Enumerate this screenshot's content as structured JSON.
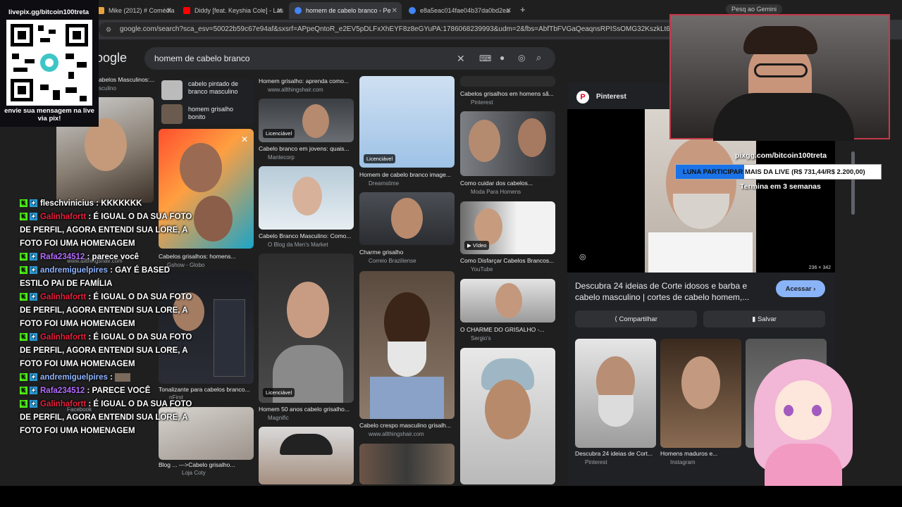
{
  "browser": {
    "tabs": [
      {
        "label": "Mike (2012) # Comédia",
        "color": "#e8a33d"
      },
      {
        "label": "Diddy [feat. Keyshia Cole] - Las",
        "color": "#ff0000"
      },
      {
        "label": "homem de cabelo branco - Pe",
        "color": "#4285f4"
      },
      {
        "label": "e8a5eac014fae04b37da0bd2ea",
        "color": "#4285f4"
      }
    ],
    "url": "google.com/search?sca_esv=50022b59c67e94af&sxsrf=APpeQntoR_e2EV5pDLFxXhEYF8z8eGYuPA:1786068239993&udm=2&fbs=AbfTbFVGaQeaqnsRPISsOMG32KszkLt6nAp8aiRKj5vMjq",
    "gemini_label": "Pesq ao Gemini"
  },
  "search": {
    "logo": "oogle",
    "query": "homem de cabelo branco"
  },
  "left_column": {
    "top_caption": "abelos Masculinos:...",
    "top_source": "sculino",
    "suggestions": [
      {
        "label": "cabelo pintado de branco masculino"
      },
      {
        "label": "homem grisalho bonito"
      }
    ],
    "captions": [
      {
        "title": "Cabelos grisalhos: homens...",
        "source": "Gshow - Globo"
      },
      {
        "title": "www.allthingshair.com",
        "source": ""
      },
      {
        "title": "Tonalizante para cabelos branco...",
        "source": "nFirst"
      },
      {
        "title": "Facebook",
        "source": ""
      },
      {
        "title": "Blog ... --->Cabelo grisalho...",
        "source": "Loja Coty"
      }
    ]
  },
  "grid": {
    "col1": [
      {
        "title": "Homem grisalho: aprenda como...",
        "source": "www.allthingshair.com"
      },
      {
        "title": "Cabelo branco em jovens: quais...",
        "source": "Mantecorp",
        "badge": "Licenciável"
      },
      {
        "title": "Cabelo Branco Masculino: Como...",
        "source": "O Blog da Men's Market"
      },
      {
        "title": "Homem 50 anos cabelo grisalho...",
        "source": "Magnific",
        "badge": "Licenciável"
      }
    ],
    "col2": [
      {
        "title": "Homem de cabelo branco image...",
        "source": "Dreamstime",
        "badge": "Licenciável"
      },
      {
        "title": "Charme grisalho",
        "source": "Correio Braziliense"
      },
      {
        "title": "Cabelo crespo masculino grisalh...",
        "source": "www.allthingshair.com"
      }
    ],
    "col3": [
      {
        "title": "Cabelos grisalhos em homens sã...",
        "source": "Pinterest"
      },
      {
        "title": "Como cuidar dos cabelos...",
        "source": "Moda Para Homens"
      },
      {
        "title": "Como Disfarçar Cabelos Brancos...",
        "source": "YouTube",
        "badge": "Vídeo"
      },
      {
        "title": "O CHARME DO GRISALHO -...",
        "source": "Sergio's"
      }
    ]
  },
  "panel": {
    "source": "Pinterest",
    "dims": "236 × 342",
    "title": "Descubra 24 ideias de Corte idosos e barba e cabelo masculino | cortes de cabelo homem,...",
    "visit_button": "Acessar",
    "share_button": "Compartilhar",
    "save_button": "Salvar",
    "related": [
      {
        "title": "Descubra 24 ideias de Cort...",
        "source": "Pinterest"
      },
      {
        "title": "Homens maduros e...",
        "source": "Instagram"
      }
    ]
  },
  "overlay": {
    "qr_url": "livepix.gg/bitcoin100treta",
    "qr_caption": "envie sua mensagem na live via pix!",
    "pix_url": "pixgg.com/bitcoin100treta",
    "goal": "LUNA PARTICIPAR MAIS DA LIVE (R$ 731,44/R$ 2.200,00)",
    "goal_deadline": "Termina em 3 semanas",
    "goal_progress": 0.332
  },
  "chat": [
    {
      "user": "fleschvinicius",
      "color": "#ffffff",
      "text": "KKKKKKK"
    },
    {
      "user": "Galinhafortt",
      "color": "#e91e3c",
      "text": "É IGUAL O DA SUA FOTO DE PERFIL, AGORA ENTENDI SUA LORE, A FOTO FOI UMA HOMENAGEM"
    },
    {
      "user": "Rafa234512",
      "color": "#b46bff",
      "text": "parece você"
    },
    {
      "user": "andremiguelpires",
      "color": "#8fb4ff",
      "text": "GAY É BASED ESTILO PAI DE FAMÍLIA"
    },
    {
      "user": "Galinhafortt",
      "color": "#e91e3c",
      "text": "É IGUAL O DA SUA FOTO DE PERFIL, AGORA ENTENDI SUA LORE, A FOTO FOI UMA HOMENAGEM"
    },
    {
      "user": "Galinhafortt",
      "color": "#e91e3c",
      "text": "É IGUAL O DA SUA FOTO DE PERFIL, AGORA ENTENDI SUA LORE, A FOTO FOI UMA HOMENAGEM"
    },
    {
      "user": "andremiguelpires",
      "color": "#8fb4ff",
      "text": ""
    },
    {
      "user": "Rafa234512",
      "color": "#b46bff",
      "text": "PARECE VOCÊ"
    },
    {
      "user": "Galinhafortt",
      "color": "#e91e3c",
      "text": "É IGUAL O DA SUA FOTO DE PERFIL, AGORA ENTENDI SUA LORE, A FOTO FOI UMA HOMENAGEM"
    }
  ]
}
